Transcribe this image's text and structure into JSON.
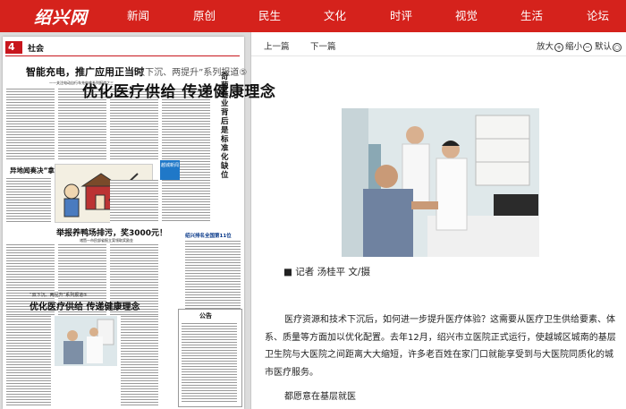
{
  "site": {
    "logo": "绍兴网"
  },
  "nav": [
    "新闻",
    "原创",
    "民生",
    "文化",
    "时评",
    "视觉",
    "生活",
    "论坛"
  ],
  "toolbar": {
    "prev": "上一篇",
    "next": "下一篇",
    "zoom_in": "放大",
    "zoom_out": "缩小",
    "default": "默认",
    "zoom_in_symbol": "+",
    "zoom_out_symbol": "−",
    "default_symbol": "○"
  },
  "article": {
    "series": "“双下沉、两提升”系列报道⑤",
    "title": "优化医疗供给 传递健康理念",
    "byline": "■ 记者 汤桂平 文/摄",
    "paragraph1": "医疗资源和技术下沉后，如何进一步提升医疗体验？这需要从医疗卫生供给要素、体系、质量等方面加以优化配置。去年12月，绍兴市立医院正式运行，使越城区城南的基层卫生院与大医院之间距离大大缩短，许多老百姓在家门口就能享受到与大医院同质化的城市医疗服务。",
    "paragraph2": "都愿意在基层就医"
  },
  "newspaper": {
    "page_no": "4",
    "section": "社会",
    "headline1": "智能充电，推广应用正当时",
    "subhead1": "——关注电动自行车充电难系列报道之三",
    "side_title": "奇葩作业背后是标准化缺位",
    "story2": "异地闻奏决“拿上”分倾权",
    "story3": "举报养鸭场排污，奖3000元！",
    "story3_sub": "诸暨一市民部省报立案领取奖励金",
    "series_small": "“双下沉、两提升”系列报道⑤",
    "headline2": "优化医疗供给  传递健康理念",
    "notice": "公告",
    "badge": "越城新闻",
    "ranking": "绍兴排名全国第11位"
  }
}
